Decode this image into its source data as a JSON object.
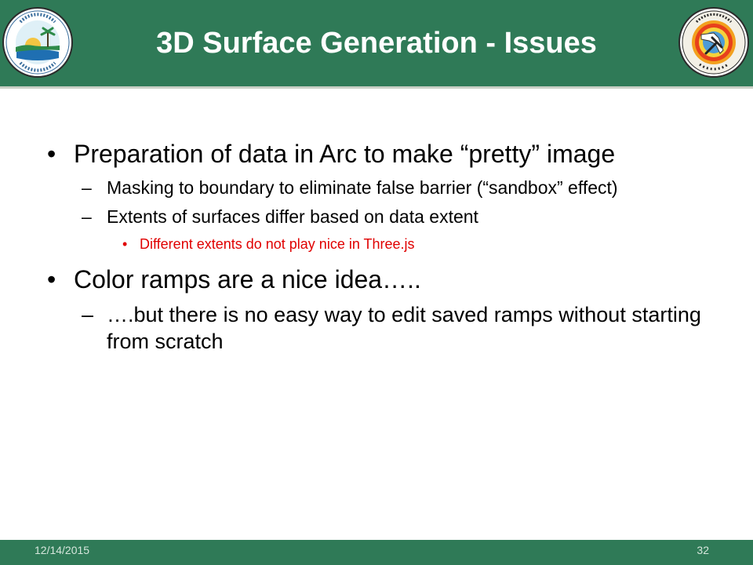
{
  "slide": {
    "title": "3D Surface Generation - Issues",
    "logos": {
      "left": {
        "name": "Florida Department of Environmental Protection",
        "ring_text": "Florida Department of Environmental Protection"
      },
      "right": {
        "name": "Florida Geological Survey",
        "ring_text": "FLORIDA GEOLOGICAL SURVEY",
        "est_text": "EST. 1907"
      }
    },
    "bullets": [
      {
        "bullet": "•",
        "text": "Preparation of data in Arc to make “pretty” image"
      },
      {
        "bullet": "–",
        "text": "Masking to boundary to eliminate false barrier (“sandbox” effect)"
      },
      {
        "bullet": "–",
        "text": "Extents of surfaces differ based on data extent"
      },
      {
        "bullet": "•",
        "text": "Different extents do not play nice in Three.js"
      },
      {
        "bullet": "•",
        "text": "Color ramps are a nice idea….."
      },
      {
        "bullet": "–",
        "text": "….but there is no easy way to edit saved ramps without starting from scratch"
      }
    ]
  },
  "footer": {
    "date": "12/14/2015",
    "page": "32"
  },
  "colors": {
    "header_green": "#2f7a57",
    "highlight_red": "#e00000"
  }
}
